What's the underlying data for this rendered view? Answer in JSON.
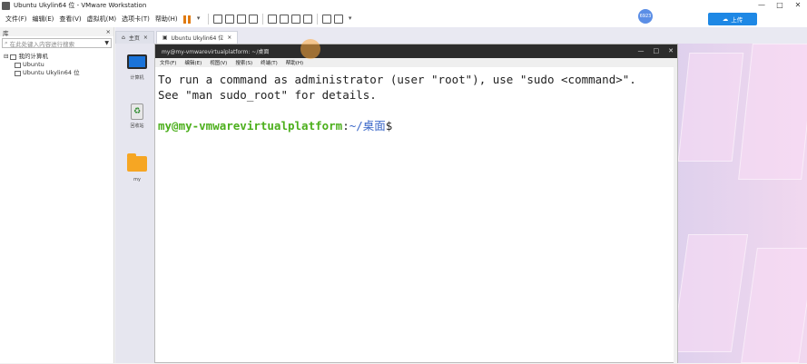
{
  "titlebar": {
    "title": "Ubuntu Ukylin64 位 - VMware Workstation",
    "controls": [
      "—",
      "□",
      "✕"
    ]
  },
  "menu": {
    "items": [
      "文件(F)",
      "编辑(E)",
      "查看(V)",
      "虚拟机(M)",
      "选项卡(T)",
      "帮助(H)"
    ]
  },
  "account": {
    "badge": "6923"
  },
  "upload": {
    "label": "上传"
  },
  "library": {
    "title": "库",
    "close": "×",
    "search_placeholder": "在此处键入内容进行搜索",
    "tree": {
      "root": "我的计算机",
      "items": [
        "Ubuntu",
        "Ubuntu Ukylin64 位"
      ]
    }
  },
  "tabs": [
    {
      "label": "主页"
    },
    {
      "label": "Ubuntu Ukylin64 位"
    }
  ],
  "dock": {
    "items": [
      "计算机",
      "回收站",
      "my"
    ]
  },
  "terminal": {
    "title": "my@my-vmwarevirtualplatform: ~/桌面",
    "menu": [
      "文件(F)",
      "编辑(E)",
      "视图(V)",
      "搜索(S)",
      "终端(T)",
      "帮助(H)"
    ],
    "lines": [
      "To run a command as administrator (user \"root\"), use \"sudo <command>\".",
      "See \"man sudo_root\" for details."
    ],
    "prompt_user": "my@my-vmwarevirtualplatform",
    "prompt_sep": ":",
    "prompt_path": "~/桌面",
    "prompt_symbol": "$",
    "controls": [
      "—",
      "□",
      "✕"
    ]
  },
  "colors": {
    "prompt_user": "#4caf1c",
    "prompt_path": "#3a67c8",
    "accent": "#1e88e5",
    "pause": "#e07a10"
  }
}
